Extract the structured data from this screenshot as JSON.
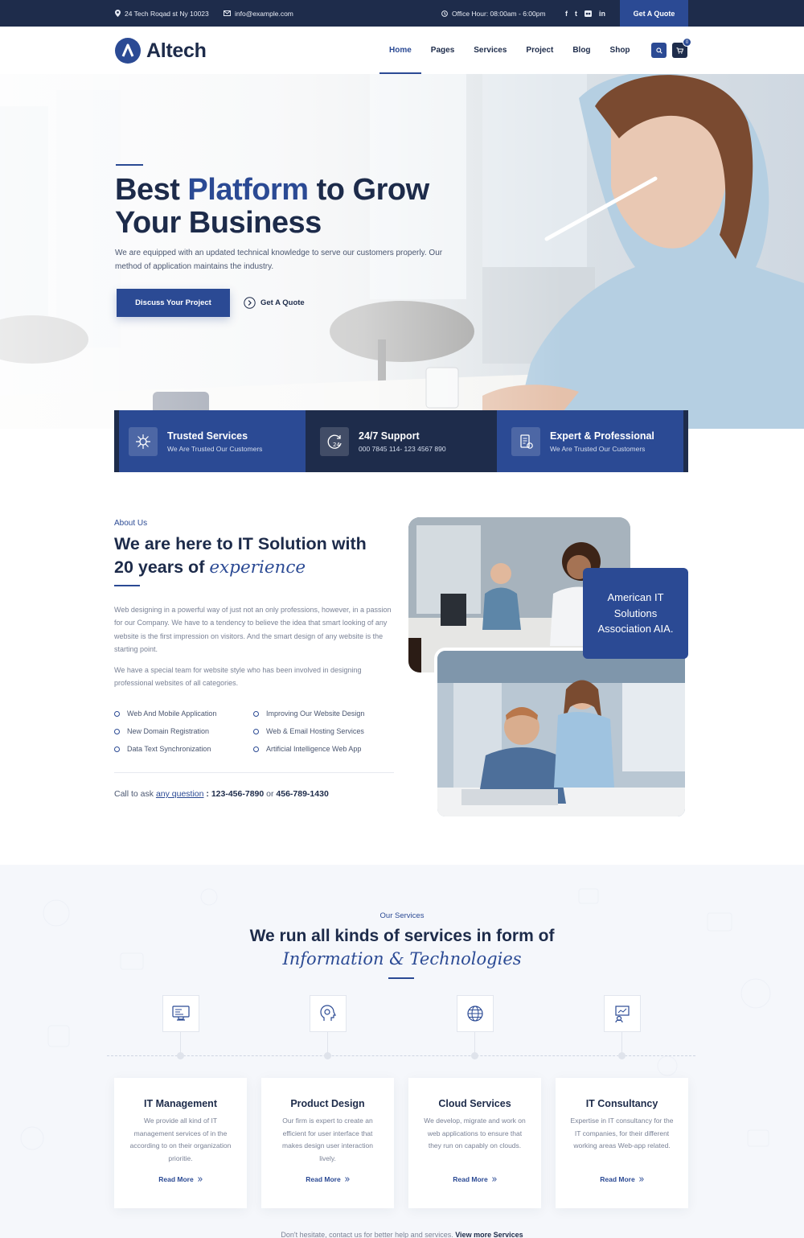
{
  "topbar": {
    "address": "24 Tech Roqad st Ny 10023",
    "email": "info@example.com",
    "hours": "Office Hour: 08:00am - 6:00pm",
    "social": [
      "f",
      "t",
      "in"
    ],
    "quote_button": "Get A Quote"
  },
  "header": {
    "logo_text": "Altech",
    "nav": [
      "Home",
      "Pages",
      "Services",
      "Project",
      "Blog",
      "Shop"
    ],
    "active_nav": "Home",
    "cart_count": "0"
  },
  "hero": {
    "title_part1": "Best ",
    "title_accent": "Platform",
    "title_part2": " to Grow",
    "title_line2": "Your Business",
    "text": "We are equipped with an updated technical knowledge to serve our customers properly. Our method of application maintains the industry.",
    "primary_button": "Discuss Your Project",
    "secondary_button": "Get A Quote"
  },
  "features": [
    {
      "title": "Trusted Services",
      "subtitle": "We Are Trusted Our Customers",
      "icon": "network-icon"
    },
    {
      "title": "24/7 Support",
      "subtitle": "000 7845 114- 123 4567 890",
      "icon": "clock-24-icon"
    },
    {
      "title": "Expert & Professional",
      "subtitle": "We Are Trusted Our Customers",
      "icon": "expert-icon"
    }
  ],
  "about": {
    "kicker": "About Us",
    "title_line1": "We are here to IT Solution with",
    "title_line2_prefix": "20 years of ",
    "title_italic": "experience",
    "paragraph1": "Web designing in a powerful way of just not an only professions, however, in a passion for our Company. We have to a tendency to believe the idea that smart looking of any website is the first impression on visitors. And the smart design of any website is the starting point.",
    "paragraph2": "We have a special team for website style who has been involved in designing professional websites of all categories.",
    "checklist": [
      "Web And Mobile Application",
      "Improving Our Website Design",
      "New Domain Registration",
      "Web & Email Hosting Services",
      "Data Text Synchronization",
      "Artificial Intelligence Web App"
    ],
    "call_prefix": "Call to ask ",
    "call_link": "any question",
    "call_sep": " : ",
    "phone1": "123-456-7890",
    "call_or": " or ",
    "phone2": "456-789-1430",
    "badge": "American IT Solutions Association AIA."
  },
  "services": {
    "kicker": "Our Services",
    "title_line1": "We run all kinds of services in form of",
    "title_line2": "Information & Technologies",
    "cards": [
      {
        "title": "IT Management",
        "desc": "We provide all kind of IT management services of in the according to on their organization prioritie.",
        "link": "Read More",
        "icon": "monitor-icon"
      },
      {
        "title": "Product Design",
        "desc": "Our firm is expert to create an efficient for user interface that makes design user interaction lively.",
        "link": "Read More",
        "icon": "head-gear-icon"
      },
      {
        "title": "Cloud Services",
        "desc": "We develop, migrate and work on web applications to ensure that they run on capably on clouds.",
        "link": "Read More",
        "icon": "globe-icon"
      },
      {
        "title": "IT Consultancy",
        "desc": "Expertise in IT consultancy for the IT companies, for their different working areas Web-app related.",
        "link": "Read More",
        "icon": "consult-icon"
      }
    ],
    "footnote_prefix": "Don't hesitate, contact us for better help and services. ",
    "footnote_link": "View more Services"
  },
  "colors": {
    "primary": "#2b4a94",
    "dark": "#1e2c4b",
    "text": "#1d2b4a",
    "muted": "#7a8296"
  }
}
